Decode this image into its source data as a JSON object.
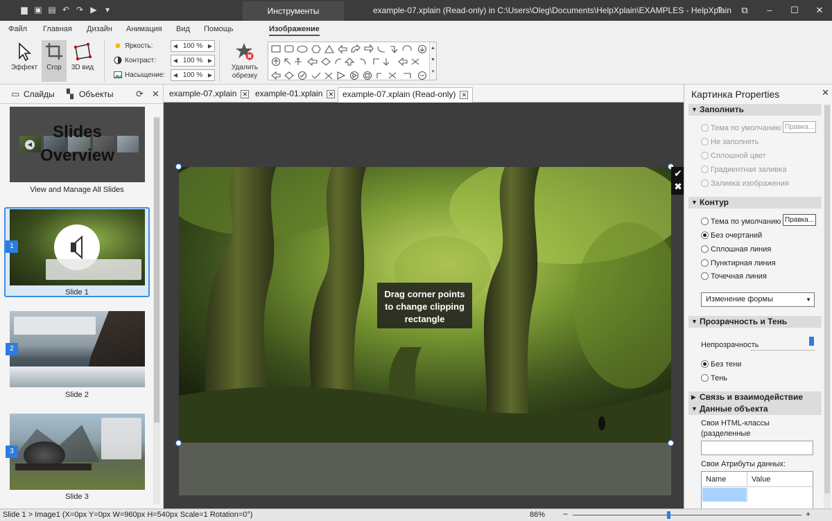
{
  "titlebar": {
    "contextual_tab": "Инструменты изображения",
    "window_title": "example-07.xplain (Read-only) in C:\\Users\\Oleg\\Documents\\HelpXplain\\EXAMPLES - HelpXplain",
    "help": "?",
    "restore": "⧉",
    "minimize": "–",
    "maximize": "☐",
    "close": "✕"
  },
  "menu": {
    "items": [
      "Файл",
      "Главная",
      "Дизайн",
      "Анимация",
      "Вид",
      "Помощь",
      "Изображение"
    ]
  },
  "ribbon": {
    "effect_label": "Эффект",
    "crop_label": "Crop",
    "view3d_label": "3D вид",
    "brightness_label": "Яркость:",
    "brightness_value": "100 %",
    "contrast_label": "Контраст:",
    "contrast_value": "100 %",
    "saturation_label": "Насыщение:",
    "saturation_value": "100 %",
    "remove_crop_label_1": "Удалить",
    "remove_crop_label_2": "обрезку"
  },
  "left_panel": {
    "tab_slides": "Слайды",
    "tab_objects": "Объекты",
    "overview_title_1": "Slides",
    "overview_title_2": "Overview",
    "overview_caption": "View and Manage All Slides",
    "slides": [
      {
        "num": "1",
        "caption": "Slide 1"
      },
      {
        "num": "2",
        "caption": "Slide 2"
      },
      {
        "num": "3",
        "caption": "Slide 3"
      }
    ]
  },
  "doc_tabs": [
    {
      "label": "example-07.xplain"
    },
    {
      "label": "example-01.xplain"
    },
    {
      "label": "example-07.xplain (Read-only)"
    }
  ],
  "canvas": {
    "hint_line1": "Drag corner points",
    "hint_line2": "to change clipping",
    "hint_line3": "rectangle",
    "ok": "✔",
    "cancel": "✖"
  },
  "right_panel": {
    "title": "Картинка Properties",
    "fill_section": "Заполнить",
    "fill_options": [
      "Тема по умолчанию",
      "Не заполнять",
      "Сплошной цвет",
      "Градиентная заливка",
      "Заливка изображения"
    ],
    "edit_button": "Правка...",
    "outline_section": "Контур",
    "outline_options": [
      "Тема по умолчанию",
      "Без очертаний",
      "Сплошная линия",
      "Пунктирная линия",
      "Точечная линия"
    ],
    "shape_change": "Изменение формы",
    "transparency_section": "Прозрачность и Тень",
    "opacity_label": "Непрозрачность",
    "opacity_value": 1.0,
    "shadow_options": [
      "Без тени",
      "Тень"
    ],
    "link_section": "Связь и взаимодействие",
    "data_section": "Данные объекта",
    "html_classes_label": "Свои HTML-классы (разделенные",
    "data_attrs_label": "Свои Атрибуты данных:",
    "col_name": "Name",
    "col_value": "Value"
  },
  "statusbar": {
    "text": "Slide 1 > Image1 (X=0px  Y=0px  W=960px  H=540px  Scale=1  Rotation=0°)",
    "zoom": "86%",
    "zoom_minus": "−",
    "zoom_plus": "+"
  },
  "colors": {
    "accent": "#2a7de1",
    "titlebar": "#3c3c3c",
    "canvas_bg": "#3d3d3d"
  }
}
